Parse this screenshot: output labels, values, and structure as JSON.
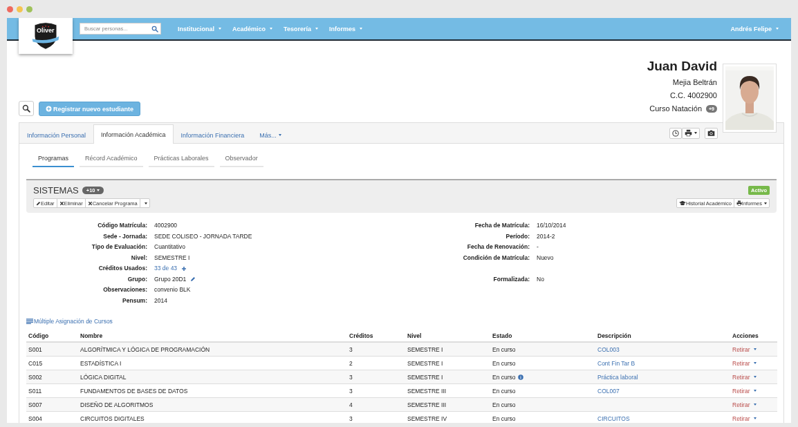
{
  "navbar": {
    "logo_text": "Oliver",
    "search": {
      "placeholder": "Buscar personas..."
    },
    "menus": [
      {
        "label": "Institucional"
      },
      {
        "label": "Académico"
      },
      {
        "label": "Tesorería"
      },
      {
        "label": "Informes"
      }
    ],
    "user": "Andrés Felipe"
  },
  "toolbar": {
    "register_button": "Registrar nuevo estudiante"
  },
  "student": {
    "first_name": "Juan David",
    "last_name": "Mejia Beltrán",
    "document": "C.C. 4002900",
    "course": "Curso Natación",
    "course_badge": "+9"
  },
  "tabs": [
    {
      "label": "Información Personal",
      "selected": false,
      "kind": "link"
    },
    {
      "label": "Información Académica",
      "selected": true,
      "kind": "link"
    },
    {
      "label": "Información Financiera",
      "selected": false,
      "kind": "link"
    },
    {
      "label": "Más...",
      "selected": false,
      "kind": "dropdown"
    }
  ],
  "subtabs": [
    {
      "label": "Programas",
      "selected": true
    },
    {
      "label": "Récord Académico",
      "selected": false
    },
    {
      "label": "Prácticas Laborales",
      "selected": false
    },
    {
      "label": "Observador",
      "selected": false
    }
  ],
  "program": {
    "title": "SISTEMAS",
    "badge": "+10",
    "status": "Activo",
    "actions": [
      {
        "label": "Editar",
        "kind": "edit"
      },
      {
        "label": "Eliminar",
        "kind": "remove"
      },
      {
        "label": "Cancelar Programa",
        "kind": "remove"
      }
    ],
    "right_actions": [
      {
        "label": "Historial Académico",
        "kind": "history",
        "dropdown": false
      },
      {
        "label": "Informes",
        "kind": "reports",
        "dropdown": true
      }
    ]
  },
  "details": [
    {
      "left": {
        "label": "Código Matrícula:",
        "value": "4002900",
        "kind": "text"
      },
      "right": {
        "label": "Fecha de Matrícula:",
        "value": "16/10/2014",
        "kind": "text"
      }
    },
    {
      "left": {
        "label": "Sede - Jornada:",
        "value": "SEDE COLISEO - JORNADA TARDE",
        "kind": "text"
      },
      "right": {
        "label": "Período:",
        "value": "2014-2",
        "kind": "text"
      }
    },
    {
      "left": {
        "label": "Tipo de Evaluación:",
        "value": "Cuantitativo",
        "kind": "text"
      },
      "right": {
        "label": "Fecha de Renovación:",
        "value": "-",
        "kind": "text"
      }
    },
    {
      "left": {
        "label": "Nivel:",
        "value": "SEMESTRE I",
        "kind": "text"
      },
      "right": {
        "label": "Condición de Matrícula:",
        "value": "Nuevo",
        "kind": "text"
      }
    },
    {
      "left": {
        "label": "Créditos Usados:",
        "value": "33 de 43",
        "kind": "addable"
      }
    },
    {
      "left": {
        "label": "Grupo:",
        "value": "Grupo 20D1",
        "kind": "editable"
      },
      "right": {
        "label": "Formalizada:",
        "value": "No",
        "kind": "text"
      }
    },
    {
      "left": {
        "label": "Observaciones:",
        "value": "convenio BLK",
        "kind": "text"
      }
    },
    {
      "left": {
        "label": "Pensum:",
        "value": "2014",
        "kind": "text"
      }
    }
  ],
  "courses_link": "Múltiple Asignación de Cursos",
  "table": {
    "columns": [
      "Código",
      "Nombre",
      "Créditos",
      "Nivel",
      "Estado",
      "Descripción",
      "Acciones"
    ],
    "rows": [
      {
        "code": "S001",
        "name": "ALGORÍTMICA Y LÓGICA DE PROGRAMACIÓN",
        "credits": "3",
        "level": "SEMESTRE I",
        "status": "En curso",
        "info": false,
        "description": "COL003",
        "action": "Retirar"
      },
      {
        "code": "C015",
        "name": "ESTADÍSTICA I",
        "credits": "2",
        "level": "SEMESTRE I",
        "status": "En curso",
        "info": false,
        "description": "Cont Fin Tar B",
        "action": "Retirar"
      },
      {
        "code": "S002",
        "name": "LÓGICA DIGITAL",
        "credits": "3",
        "level": "SEMESTRE I",
        "status": "En curso",
        "info": true,
        "description": "Práctica laboral",
        "action": "Retirar"
      },
      {
        "code": "S011",
        "name": "FUNDAMENTOS DE BASES DE DATOS",
        "credits": "3",
        "level": "SEMESTRE III",
        "status": "En curso",
        "info": false,
        "description": "COL007",
        "action": "Retirar"
      },
      {
        "code": "S007",
        "name": "DISEÑO DE ALGORITMOS",
        "credits": "4",
        "level": "SEMESTRE III",
        "status": "En curso",
        "info": false,
        "action": "Retirar"
      },
      {
        "code": "S004",
        "name": "CIRCUITOS DIGITALES",
        "credits": "3",
        "level": "SEMESTRE IV",
        "status": "En curso",
        "info": false,
        "description": "CIRCUITOS",
        "action": "Retirar"
      }
    ]
  }
}
